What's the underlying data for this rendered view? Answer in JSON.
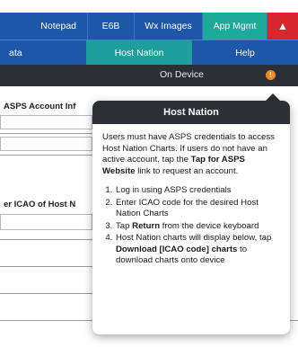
{
  "tabs": {
    "notepad": "Notepad",
    "e6b": "E6B",
    "wx_images": "Wx Images",
    "app_mgmt": "App Mgmt",
    "alert": "▲"
  },
  "subtabs": {
    "data": "ata",
    "host_nation": "Host Nation",
    "help": "Help"
  },
  "device_bar": {
    "label": "On Device",
    "badge": "!"
  },
  "background": {
    "account_label": "ASPS Account Inf",
    "icao_label": "er ICAO of Host N"
  },
  "popover": {
    "title": "Host Nation",
    "intro_1": "Users must have ASPS credentials to access Host Nation Charts. If users do not have an active account, tap the ",
    "intro_link": "Tap for ASPS Website",
    "intro_2": " link to request an account.",
    "step1": "Log in using ASPS credentials",
    "step2": "Enter ICAO code for the desired Host Nation Charts",
    "step3_a": "Tap ",
    "step3_b": "Return",
    "step3_c": " from the device keyboard",
    "step4_a": "Host Nation charts will display below, tap ",
    "step4_b": "Download [ICAO code] charts",
    "step4_c": " to download charts onto device"
  },
  "colors": {
    "tab_blue": "#1e56a8",
    "active_teal": "#1eaa9a",
    "alert_red": "#d8282b",
    "header_dark": "#2a3036",
    "badge_orange": "#f08a1c"
  }
}
